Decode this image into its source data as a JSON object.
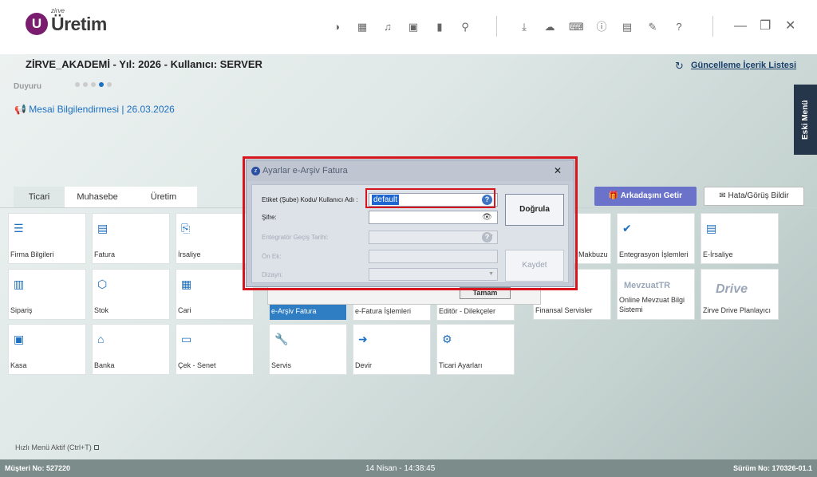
{
  "app": {
    "logo_letter": "U",
    "logo_small": "zirve",
    "logo_big": "Üretim"
  },
  "header": {
    "company_line": "ZİRVE_AKADEMİ - Yıl: 2026 - Kullanıcı: SERVER",
    "update_link": "Güncelleme İçerik Listesi"
  },
  "announcement": {
    "label": "Duyuru",
    "text": "Mesai Bilgilendirmesi | 26.03.2026"
  },
  "side_tab": "Eski Menü",
  "tabs": [
    {
      "label": "Ticari"
    },
    {
      "label": "Muhasebe"
    },
    {
      "label": "Üretim"
    }
  ],
  "buttons": {
    "friend": "Arkadaşını Getir",
    "bug": "Hata/Görüş Bildir"
  },
  "tiles": {
    "firma": "Firma Bilgileri",
    "fatura": "Fatura",
    "irsaliye": "İrsaliye",
    "siparis": "Sipariş",
    "stok": "Stok",
    "cari": "Cari",
    "kasa": "Kasa",
    "banka": "Banka",
    "cek": "Çek - Senet",
    "earsiv": "e-Arşiv Fatura",
    "efatura": "e-Fatura İşlemleri",
    "editor": "Editör - Dilekçeler",
    "servis": "Servis",
    "devir": "Devir",
    "ticari_ayar": "Ticari Ayarları",
    "makbuz": "Makbuzu",
    "finansal": "Finansal Servisler",
    "entegrasyon": "Entegrasyon İşlemleri",
    "eirsaliye": "E-İrsaliye",
    "mevzuat_brand": "MevzuatTR",
    "mevzuat": "Online Mevzuat Bilgi Sistemi",
    "drive_brand": "Drive",
    "drive": "Zirve Drive Planlayıcı"
  },
  "back_dialog": {
    "ok": "Tamam"
  },
  "dialog": {
    "title": "Ayarlar e-Arşiv Fatura",
    "label_user": "Etiket (Şube) Kodu/ Kullanıcı Adı :",
    "value_user": "default",
    "label_password": "Şifre:",
    "label_date": "Entegratör Geçiş Tarihi:",
    "label_prefix": "Ön Ek:",
    "label_design": "Dizayn:",
    "verify": "Doğrula",
    "save": "Kaydet"
  },
  "footer": {
    "quick_menu": "Hızlı Menü Aktif (Ctrl+T)",
    "customer": "Müşteri No: 527220",
    "datetime": "14 Nisan - 14:38:45",
    "version": "Sürüm No: 170326-01.1"
  }
}
